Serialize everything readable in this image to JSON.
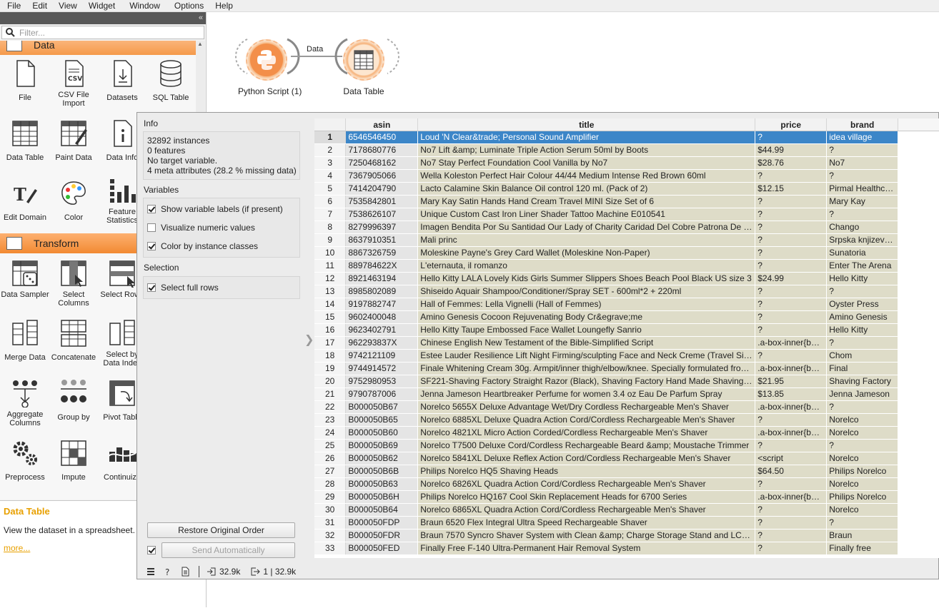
{
  "menu": [
    "File",
    "Edit",
    "View",
    "Widget",
    "Window",
    "Options",
    "Help"
  ],
  "filter": {
    "placeholder": "Filter..."
  },
  "toolbox": {
    "categories": [
      {
        "label": "Data"
      },
      {
        "label": "Transform"
      }
    ],
    "data_tools": [
      "File",
      "CSV File Import",
      "Datasets",
      "SQL Table",
      "Data Table",
      "Paint Data",
      "Data Info",
      "Edit Domain",
      "Color",
      "Feature Statistics"
    ],
    "transform_tools": [
      "Data Sampler",
      "Select Columns",
      "Select Rows",
      "Merge Data",
      "Concatenate",
      "Select by Data Index",
      "Aggregate Columns",
      "Group by",
      "Pivot Table",
      "Preprocess",
      "Impute",
      "Continuize"
    ]
  },
  "help": {
    "title": "Data Table",
    "text": "View the dataset in a spreadsheet.",
    "more": "more..."
  },
  "canvas": {
    "nodes": [
      {
        "label": "Python Script (1)"
      },
      {
        "label": "Data Table"
      }
    ],
    "link_label": "Data"
  },
  "widget": {
    "info_title": "Info",
    "info_lines": [
      "32892 instances",
      "0  features",
      "No target variable.",
      "4 meta attributes (28.2 % missing data)"
    ],
    "variables_title": "Variables",
    "variables": [
      {
        "label": "Show variable labels (if present)",
        "checked": true
      },
      {
        "label": "Visualize numeric values",
        "checked": false
      },
      {
        "label": "Color by instance classes",
        "checked": true
      }
    ],
    "selection_title": "Selection",
    "select_full_rows": {
      "label": "Select full rows",
      "checked": true
    },
    "restore_button": "Restore Original Order",
    "send_button": "Send Automatically",
    "status": {
      "input": "32.9k",
      "output": "1 | 32.9k"
    }
  },
  "table": {
    "columns": [
      "asin",
      "title",
      "price",
      "brand"
    ],
    "selected_row": 1,
    "rows": [
      [
        "1",
        "6546546450",
        "Loud 'N Clear&trade; Personal Sound Amplifier",
        "?",
        "idea village"
      ],
      [
        "2",
        "7178680776",
        "No7 Lift &amp; Luminate Triple Action Serum 50ml by Boots",
        "$44.99",
        "?"
      ],
      [
        "3",
        "7250468162",
        "No7 Stay Perfect Foundation Cool Vanilla by No7",
        "$28.76",
        "No7"
      ],
      [
        "4",
        "7367905066",
        "Wella Koleston Perfect Hair Colour 44/44 Medium Intense Red Brown 60ml",
        "?",
        "?"
      ],
      [
        "5",
        "7414204790",
        "Lacto Calamine Skin Balance Oil control 120 ml. (Pack of 2)",
        "$12.15",
        "Pirmal Healthc…"
      ],
      [
        "6",
        "7535842801",
        "Mary Kay Satin Hands Hand Cream Travel MINI Size Set of 6",
        "?",
        "Mary Kay"
      ],
      [
        "7",
        "7538626107",
        "Unique Custom Cast Iron Liner Shader Tattoo Machine E010541",
        "?",
        "?"
      ],
      [
        "8",
        "8279996397",
        "Imagen Bendita Por Su Santidad Our Lady of Charity Caridad Del Cobre Patrona De …",
        "?",
        "Chango"
      ],
      [
        "9",
        "8637910351",
        "Mali princ",
        "?",
        "Srpska knjizev…"
      ],
      [
        "10",
        "8867326759",
        "Moleskine Payne's Grey Card Wallet (Moleskine Non-Paper)",
        "?",
        "Sunatoria"
      ],
      [
        "11",
        "889784622X",
        "L'eternauta, il romanzo",
        "?",
        "Enter The Arena"
      ],
      [
        "12",
        "8921463194",
        "Hello Kitty LALA Lovely Kids Girls Summer Slippers Shoes Beach Pool Black US size 3",
        "$24.99",
        "Hello Kitty"
      ],
      [
        "13",
        "8985802089",
        "Shiseido Aquair Shampoo/Conditioner/Spray SET - 600ml*2 + 220ml",
        "?",
        "?"
      ],
      [
        "14",
        "9197882747",
        "Hall of Femmes: Lella Vignelli (Hall of Femmes)",
        "?",
        "Oyster Press"
      ],
      [
        "15",
        "9602400048",
        "Amino Genesis Cocoon Rejuvenating Body Cr&egrave;me",
        "?",
        "Amino Genesis"
      ],
      [
        "16",
        "9623402791",
        "Hello Kitty Taupe Embossed Face Wallet Loungefly Sanrio",
        "?",
        "Hello Kitty"
      ],
      [
        "17",
        "962293837X",
        "Chinese English New Testament of the Bible-Simplified Script",
        ".a-box-inner{b…",
        "?"
      ],
      [
        "18",
        "9742121109",
        "Estee Lauder Resilience Lift Night Firming/sculpting Face and Neck Creme (Travel Si…",
        "?",
        "Chom"
      ],
      [
        "19",
        "9744914572",
        "Finale Whitening Cream 30g. Armpit/inner thigh/elbow/knee. Specially formulated fro…",
        ".a-box-inner{b…",
        "Final"
      ],
      [
        "20",
        "9752980953",
        "SF221-Shaving Factory Straight Razor (Black), Shaving Factory Hand Made Shaving…",
        "$21.95",
        "Shaving Factory"
      ],
      [
        "21",
        "9790787006",
        "Jenna Jameson Heartbreaker Perfume for women 3.4 oz Eau De Parfum Spray",
        "$13.85",
        "Jenna Jameson"
      ],
      [
        "22",
        "B000050B67",
        "Norelco 5655X Deluxe Advantage Wet/Dry Cordless Rechargeable Men's Shaver",
        ".a-box-inner{b…",
        "?"
      ],
      [
        "23",
        "B000050B65",
        "Norelco 6885XL Deluxe Quadra Action Cord/Cordless Rechargeable Men's Shaver",
        "?",
        "Norelco"
      ],
      [
        "24",
        "B000050B60",
        "Norelco 4821XL Micro Action Corded/Cordless Rechargeable Men's Shaver",
        ".a-box-inner{b…",
        "Norelco"
      ],
      [
        "25",
        "B000050B69",
        "Norelco T7500 Deluxe Cord/Cordless Rechargeable Beard &amp; Moustache Trimmer",
        "?",
        "?"
      ],
      [
        "26",
        "B000050B62",
        "Norelco 5841XL Deluxe Reflex Action Cord/Cordless Rechargeable Men's Shaver",
        "<script",
        "Norelco"
      ],
      [
        "27",
        "B000050B6B",
        "Philips Norelco HQ5 Shaving Heads",
        "$64.50",
        "Philips Norelco"
      ],
      [
        "28",
        "B000050B63",
        "Norelco 6826XL Quadra Action Cord/Cordless Rechargeable Men's Shaver",
        "?",
        "Norelco"
      ],
      [
        "29",
        "B000050B6H",
        "Philips Norelco HQ167 Cool Skin Replacement Heads for 6700 Series",
        ".a-box-inner{b…",
        "Philips Norelco"
      ],
      [
        "30",
        "B000050B64",
        "Norelco 6865XL Quadra Action Cord/Cordless Rechargeable Men's Shaver",
        "?",
        "Norelco"
      ],
      [
        "31",
        "B000050FDP",
        "Braun 6520 Flex Integral Ultra Speed Rechargeable Shaver",
        "?",
        "?"
      ],
      [
        "32",
        "B000050FDR",
        "Braun 7570 Syncro Shaver System with Clean &amp; Charge Storage Stand and LC…",
        "?",
        "Braun"
      ],
      [
        "33",
        "B000050FED",
        "Finally Free F-140 Ultra-Permanent Hair Removal System",
        "?",
        "Finally free"
      ]
    ]
  }
}
